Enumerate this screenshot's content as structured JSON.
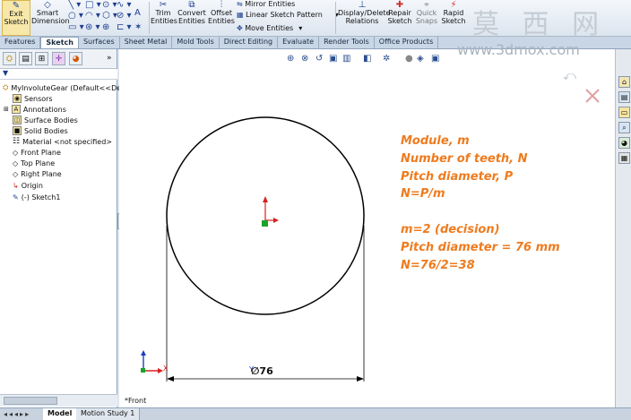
{
  "toolbar": {
    "exit_sketch": "Exit Sketch",
    "smart_dimension": "Smart Dimension",
    "trim_entities": "Trim Entities",
    "convert_entities": "Convert Entities",
    "offset_entities": "Offset Entities",
    "mirror_entities": "Mirror Entities",
    "linear_sketch_pattern": "Linear Sketch Pattern",
    "move_entities": "Move Entities",
    "display_delete_relations": "Display/Delete Relations",
    "repair_sketch": "Repair Sketch",
    "quick_snaps": "Quick Snaps",
    "rapid_sketch": "Rapid Sketch"
  },
  "tabs": [
    "Features",
    "Sketch",
    "Surfaces",
    "Sheet Metal",
    "Mold Tools",
    "Direct Editing",
    "Evaluate",
    "Render Tools",
    "Office Products"
  ],
  "active_tab": "Sketch",
  "tree": {
    "root": "MyInvoluteGear  (Default<<Def",
    "items": [
      "Sensors",
      "Annotations",
      "Surface Bodies",
      "Solid Bodies",
      "Material <not specified>",
      "Front Plane",
      "Top Plane",
      "Right Plane",
      "Origin",
      "(-) Sketch1"
    ]
  },
  "canvas": {
    "view_label": "*Front",
    "dimension": "∅76",
    "axis_y": "Y",
    "axis_x": "X",
    "notes": [
      "Module, m",
      "Number of teeth, N",
      "Pitch diameter, P",
      "N=P/m",
      "m=2 (decision)",
      "Pitch diameter = 76 mm",
      "N=76/2=38"
    ]
  },
  "bottom_tabs": [
    "Model",
    "Motion Study 1"
  ],
  "active_bottom_tab": "Model",
  "watermark": {
    "chars": "莫 西 网",
    "url": "www.3dmox.com"
  },
  "colors": {
    "note": "#ef7b1e",
    "accent": "#1f3f8f"
  }
}
